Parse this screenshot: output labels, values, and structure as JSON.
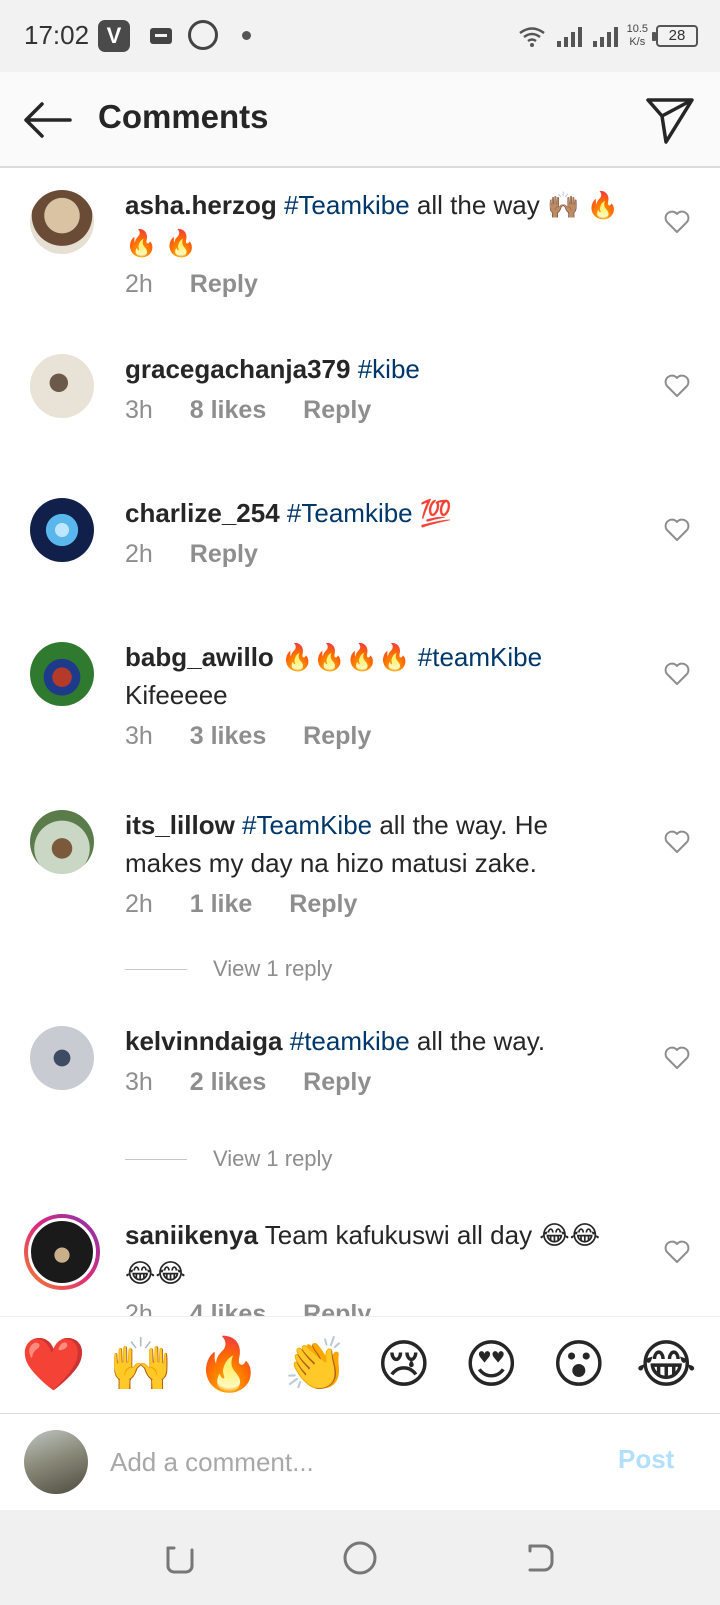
{
  "status_bar": {
    "time": "17:02",
    "vapp_letter": "V",
    "net_speed_value": "10.5",
    "net_speed_unit": "K/s",
    "battery": "28",
    "icons": [
      "vapp-icon",
      "message-icon",
      "whatsapp-icon",
      "wifi-icon",
      "signal-icon",
      "battery-icon"
    ]
  },
  "header": {
    "title": "Comments",
    "back_icon": "arrow-left-icon",
    "send_icon": "paper-plane-icon"
  },
  "comments": [
    {
      "username": "asha.herzog",
      "tag": "#Teamkibe",
      "text": " all the way 🙌🏽 🔥 🔥 🔥",
      "time": "2h",
      "likes": "",
      "reply_label": "Reply",
      "avatar_colors": [
        "#d9c3a3",
        "#6a4b35"
      ]
    },
    {
      "username": "gracegachanja379",
      "tag": "#kibe",
      "text": "",
      "time": "3h",
      "likes": "8 likes",
      "reply_label": "Reply",
      "avatar_colors": [
        "#e9e2d6",
        "#6b5a4a"
      ]
    },
    {
      "username": "charlize_254",
      "tag": "#Teamkibe",
      "text": " 💯",
      "time": "2h",
      "likes": "",
      "reply_label": "Reply",
      "avatar_colors": [
        "#5ab7ee",
        "#10204a"
      ]
    },
    {
      "username": "babg_awillo",
      "tag": "#teamKibe",
      "text_before_tag": " 🔥🔥🔥🔥",
      "text": " Kifeeeee",
      "time": "3h",
      "likes": "3 likes",
      "reply_label": "Reply",
      "avatar_colors": [
        "#2f7a2f",
        "#b53a2a"
      ]
    },
    {
      "username": "its_lillow",
      "tag": "#TeamKibe",
      "text": " all the way. He makes my day na hizo matusi zake.",
      "time": "2h",
      "likes": "1 like",
      "reply_label": "Reply",
      "view_replies": "View 1 reply",
      "avatar_colors": [
        "#c9d7c4",
        "#5a7b4a"
      ]
    },
    {
      "username": "kelvinndaiga",
      "tag": "#teamkibe",
      "text": " all the way.",
      "time": "3h",
      "likes": "2 likes",
      "reply_label": "Reply",
      "view_replies": "View 1 reply",
      "avatar_colors": [
        "#c8ccd2",
        "#3d4b63"
      ]
    },
    {
      "username": "saniikenya",
      "tag": "",
      "text": " Team kafukuswi all day 😂😂😂😂",
      "time": "2h",
      "likes": "4 likes",
      "reply_label": "Reply",
      "avatar_colors": [
        "#1a1a1a",
        "#c9b08a"
      ],
      "has_story": true
    }
  ],
  "emoji_bar": [
    "❤️",
    "🙌",
    "🔥",
    "👏",
    "😢",
    "😍",
    "😮",
    "😂"
  ],
  "composer": {
    "placeholder": "Add a comment...",
    "post_label": "Post"
  },
  "nav_bar": {
    "icons": [
      "recent-apps-icon",
      "home-icon",
      "back-icon"
    ]
  },
  "colors": {
    "hashtag": "#00376b",
    "meta_gray": "#8e8e8e",
    "post_disabled": "#b2dffc"
  }
}
